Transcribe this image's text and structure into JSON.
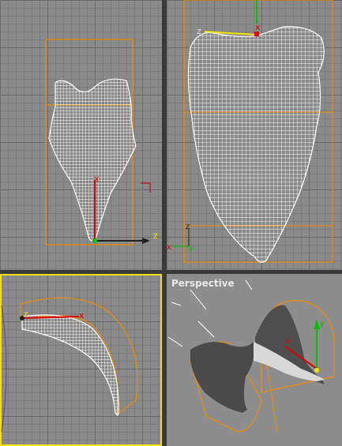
{
  "viewports": {
    "front": {
      "label": ""
    },
    "left": {
      "label": ""
    },
    "top": {
      "label": ""
    },
    "perspective": {
      "label": "Perspective"
    }
  },
  "axes": {
    "x": "x",
    "y": "y",
    "z": "z"
  },
  "colors": {
    "background": "#8a8a8a",
    "grid_major": "#6a6a6a",
    "grid_minor": "#7d7d7d",
    "selection_box": "#f08c00",
    "mesh_wire": "#ffffff",
    "active_border": "#f2e400",
    "axis_x": "#e00000",
    "axis_y": "#00c000"
  }
}
